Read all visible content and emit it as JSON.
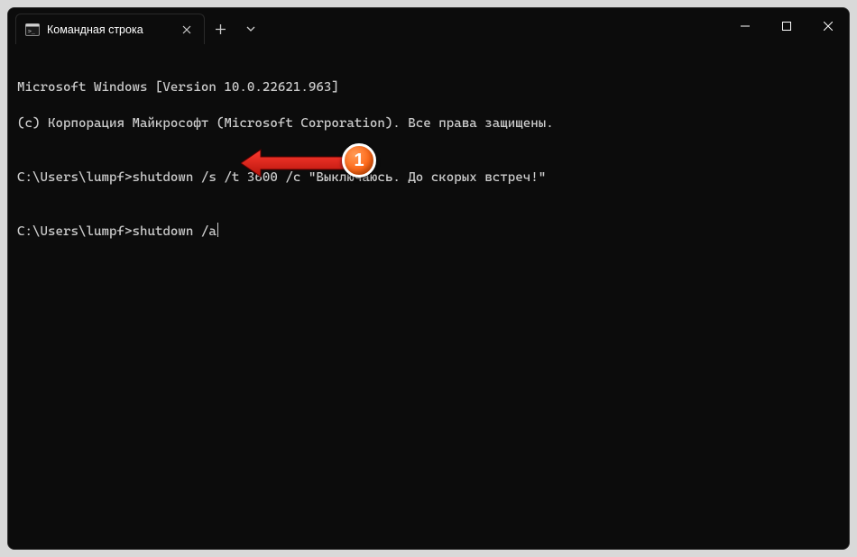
{
  "tab": {
    "title": "Командная строка"
  },
  "terminal": {
    "line1": "Microsoft Windows [Version 10.0.22621.963]",
    "line2": "(c) Корпорация Майкрософт (Microsoft Corporation). Все права защищены.",
    "blank1": "",
    "prompt1_prefix": "C:\\Users\\lumpf>",
    "prompt1_cmd": "shutdown /s /t 3600 /c \"Выключаюсь. До скорых встреч!\"",
    "blank2": "",
    "prompt2_prefix": "C:\\Users\\lumpf>",
    "prompt2_cmd": "shutdown /a"
  },
  "annotation": {
    "badge_number": "1"
  }
}
